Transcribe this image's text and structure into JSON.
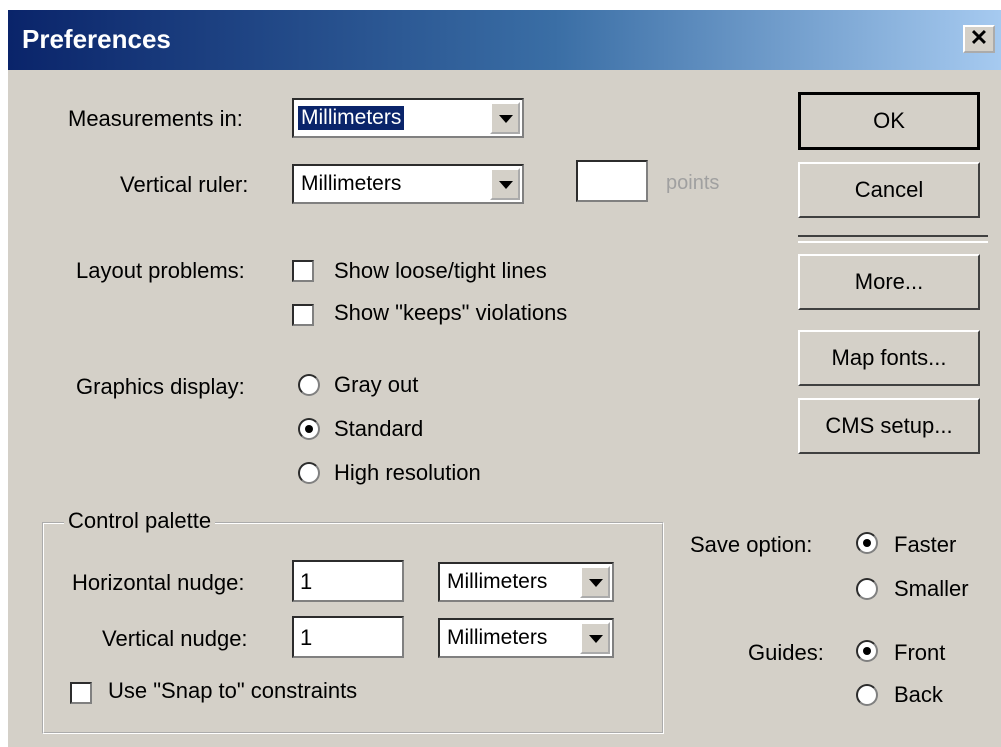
{
  "window": {
    "title": "Preferences",
    "close_glyph": "✕"
  },
  "measurements": {
    "label": "Measurements in:",
    "value": "Millimeters"
  },
  "vertical_ruler": {
    "label": "Vertical ruler:",
    "value": "Millimeters",
    "points_value": "",
    "points_label": "points"
  },
  "layout_problems": {
    "label": "Layout problems:",
    "options": [
      {
        "label": "Show loose/tight lines",
        "checked": false
      },
      {
        "label": "Show \"keeps\" violations",
        "checked": false
      }
    ]
  },
  "graphics_display": {
    "label": "Graphics display:",
    "options": [
      "Gray out",
      "Standard",
      "High resolution"
    ],
    "selected": "Standard"
  },
  "control_palette": {
    "title": "Control palette",
    "horizontal_label": "Horizontal nudge:",
    "horizontal_value": "1",
    "horizontal_unit": "Millimeters",
    "vertical_label": "Vertical nudge:",
    "vertical_value": "1",
    "vertical_unit": "Millimeters",
    "snap_label": "Use \"Snap to\" constraints",
    "snap_checked": false
  },
  "buttons": {
    "ok": "OK",
    "cancel": "Cancel",
    "more": "More...",
    "map_fonts": "Map fonts...",
    "cms_setup": "CMS setup..."
  },
  "save_option": {
    "label": "Save option:",
    "options": [
      "Faster",
      "Smaller"
    ],
    "selected": "Faster"
  },
  "guides": {
    "label": "Guides:",
    "options": [
      "Front",
      "Back"
    ],
    "selected": "Front"
  },
  "colors": {
    "dialog_face": "#d4d0c8",
    "title_bar": "#0a246a",
    "selection": "#0a246a"
  }
}
